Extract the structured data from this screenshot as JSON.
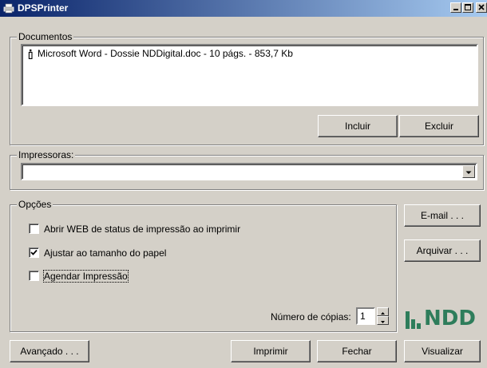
{
  "window": {
    "title": "DPSPrinter"
  },
  "documents": {
    "legend": "Documentos",
    "items": [
      {
        "text": "Microsoft Word - Dossie NDDigital.doc  -  10 págs.  -  853,7 Kb",
        "icon": "printer-icon"
      }
    ],
    "include_label": "Incluir",
    "exclude_label": "Excluir"
  },
  "printers": {
    "legend": "Impressoras:",
    "selected": ""
  },
  "options": {
    "legend": "Opções",
    "items": [
      {
        "label": "Abrir WEB de status de impressão ao imprimir",
        "checked": false
      },
      {
        "label": "Ajustar ao tamanho do papel",
        "checked": true
      },
      {
        "label": "Agendar Impressão",
        "checked": false
      }
    ],
    "copies_label": "Número de cópias:",
    "copies_value": "1"
  },
  "side_buttons": {
    "email_label": "E-mail . . .",
    "archive_label": "Arquivar . . ."
  },
  "logo": {
    "text": "NDD",
    "color": "#2e7d5b"
  },
  "footer": {
    "advanced_label": "Avançado . . .",
    "print_label": "Imprimir",
    "close_label": "Fechar",
    "preview_label": "Visualizar"
  },
  "colors": {
    "title_start": "#0a246a",
    "title_end": "#a6caf0",
    "face": "#d4d0c8"
  }
}
